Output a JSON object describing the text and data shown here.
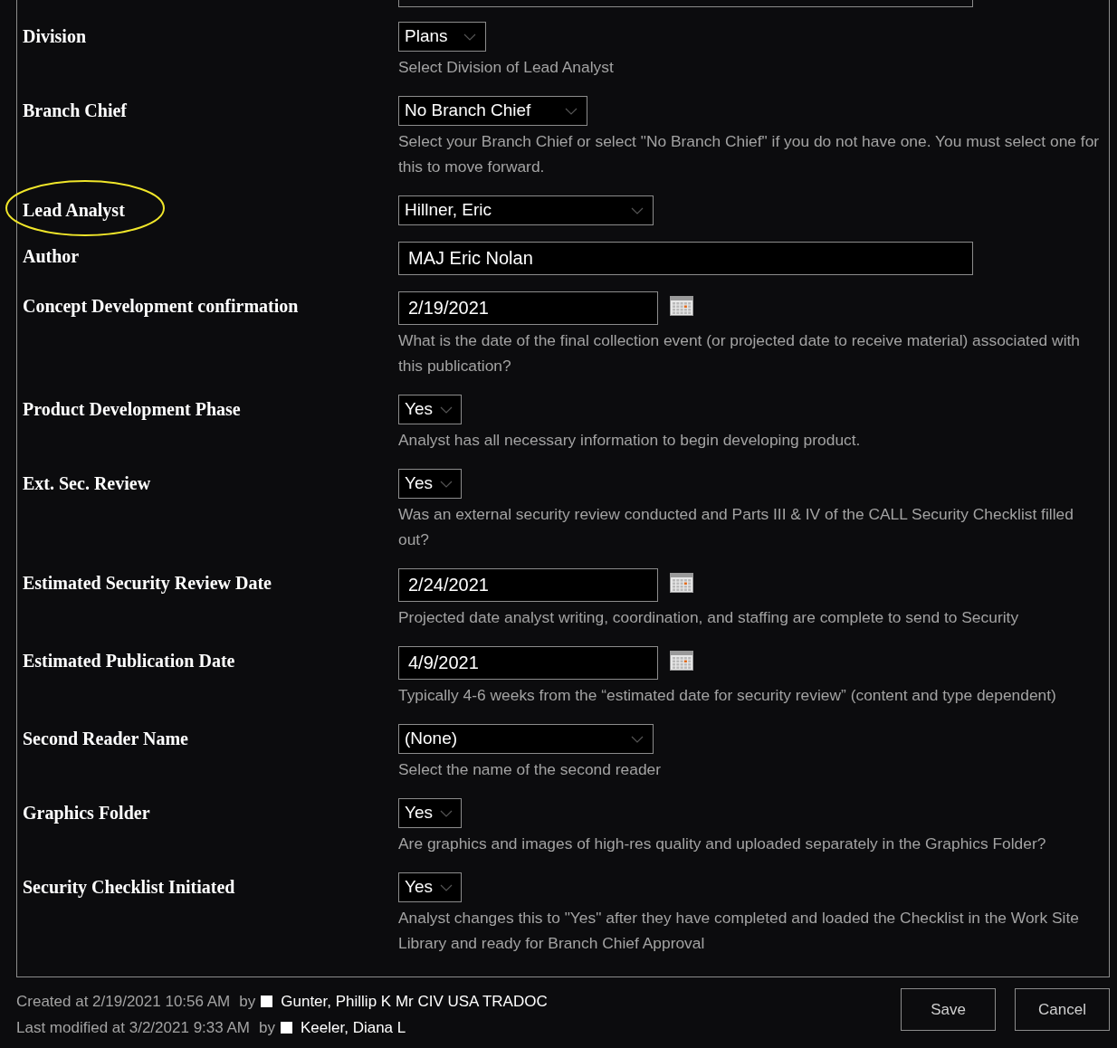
{
  "fields": [
    {
      "label": "Division",
      "kind": "select",
      "value": "Plans",
      "description": "Select Division of Lead Analyst",
      "highlighted": false
    },
    {
      "label": "Branch Chief",
      "kind": "select",
      "value": "No Branch Chief",
      "description": "Select your Branch Chief or select \"No Branch Chief\" if you do not have one.  You must select one for this to move forward.",
      "highlighted": false
    },
    {
      "label": "Lead Analyst",
      "kind": "select",
      "value": "Hillner, Eric",
      "highlighted": true
    },
    {
      "label": "Author",
      "kind": "text",
      "value": "MAJ Eric Nolan",
      "highlighted": false
    },
    {
      "label": "Concept Development confirmation",
      "kind": "date",
      "value": "2/19/2021",
      "description": "What is the date of the final collection event (or projected date to receive material) associated with this publication?",
      "highlighted": false
    },
    {
      "label": "Product Development Phase",
      "kind": "select",
      "value": "Yes",
      "description": "Analyst has all necessary information to begin developing product.",
      "highlighted": false
    },
    {
      "label": "Ext. Sec. Review",
      "kind": "select",
      "value": "Yes",
      "description": "Was an external security review conducted and Parts III & IV of the CALL Security Checklist filled out?",
      "highlighted": false
    },
    {
      "label": "Estimated Security Review Date",
      "kind": "date",
      "value": "2/24/2021",
      "description": "Projected date analyst writing, coordination, and staffing are complete to send to Security",
      "highlighted": false
    },
    {
      "label": "Estimated Publication Date",
      "kind": "date",
      "value": "4/9/2021",
      "description": "Typically 4-6 weeks from the “estimated date for security review” (content and type dependent)",
      "highlighted": false
    },
    {
      "label": "Second Reader Name",
      "kind": "select",
      "value": "(None)",
      "description": "Select the name of the second reader",
      "highlighted": false
    },
    {
      "label": "Graphics Folder",
      "kind": "select",
      "value": "Yes",
      "description": "Are graphics and images of high-res quality and uploaded separately in the Graphics Folder?",
      "highlighted": false
    },
    {
      "label": "Security Checklist Initiated",
      "kind": "select",
      "value": "Yes",
      "description": "Analyst changes this to \"Yes\" after they have completed and loaded the Checklist in the Work Site Library and ready for Branch Chief Approval",
      "highlighted": false
    }
  ],
  "footer": {
    "created": {
      "text": "Created at 2/19/2021 10:56 AM",
      "by": "by",
      "user": "Gunter, Phillip K Mr CIV USA TRADOC"
    },
    "modified": {
      "text": "Last modified at 3/2/2021 9:33 AM",
      "by": "by",
      "user": "Keeler, Diana L"
    }
  },
  "buttons": [
    "Save",
    "Cancel"
  ]
}
